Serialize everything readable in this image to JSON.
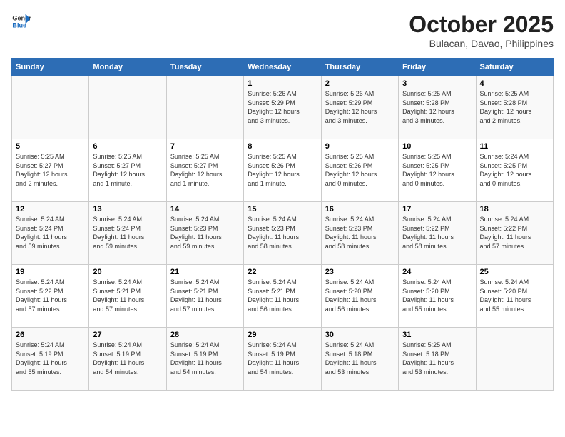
{
  "header": {
    "logo_line1": "General",
    "logo_line2": "Blue",
    "month": "October 2025",
    "location": "Bulacan, Davao, Philippines"
  },
  "weekdays": [
    "Sunday",
    "Monday",
    "Tuesday",
    "Wednesday",
    "Thursday",
    "Friday",
    "Saturday"
  ],
  "weeks": [
    [
      {
        "day": "",
        "info": ""
      },
      {
        "day": "",
        "info": ""
      },
      {
        "day": "",
        "info": ""
      },
      {
        "day": "1",
        "info": "Sunrise: 5:26 AM\nSunset: 5:29 PM\nDaylight: 12 hours\nand 3 minutes."
      },
      {
        "day": "2",
        "info": "Sunrise: 5:26 AM\nSunset: 5:29 PM\nDaylight: 12 hours\nand 3 minutes."
      },
      {
        "day": "3",
        "info": "Sunrise: 5:25 AM\nSunset: 5:28 PM\nDaylight: 12 hours\nand 3 minutes."
      },
      {
        "day": "4",
        "info": "Sunrise: 5:25 AM\nSunset: 5:28 PM\nDaylight: 12 hours\nand 2 minutes."
      }
    ],
    [
      {
        "day": "5",
        "info": "Sunrise: 5:25 AM\nSunset: 5:27 PM\nDaylight: 12 hours\nand 2 minutes."
      },
      {
        "day": "6",
        "info": "Sunrise: 5:25 AM\nSunset: 5:27 PM\nDaylight: 12 hours\nand 1 minute."
      },
      {
        "day": "7",
        "info": "Sunrise: 5:25 AM\nSunset: 5:27 PM\nDaylight: 12 hours\nand 1 minute."
      },
      {
        "day": "8",
        "info": "Sunrise: 5:25 AM\nSunset: 5:26 PM\nDaylight: 12 hours\nand 1 minute."
      },
      {
        "day": "9",
        "info": "Sunrise: 5:25 AM\nSunset: 5:26 PM\nDaylight: 12 hours\nand 0 minutes."
      },
      {
        "day": "10",
        "info": "Sunrise: 5:25 AM\nSunset: 5:25 PM\nDaylight: 12 hours\nand 0 minutes."
      },
      {
        "day": "11",
        "info": "Sunrise: 5:24 AM\nSunset: 5:25 PM\nDaylight: 12 hours\nand 0 minutes."
      }
    ],
    [
      {
        "day": "12",
        "info": "Sunrise: 5:24 AM\nSunset: 5:24 PM\nDaylight: 11 hours\nand 59 minutes."
      },
      {
        "day": "13",
        "info": "Sunrise: 5:24 AM\nSunset: 5:24 PM\nDaylight: 11 hours\nand 59 minutes."
      },
      {
        "day": "14",
        "info": "Sunrise: 5:24 AM\nSunset: 5:23 PM\nDaylight: 11 hours\nand 59 minutes."
      },
      {
        "day": "15",
        "info": "Sunrise: 5:24 AM\nSunset: 5:23 PM\nDaylight: 11 hours\nand 58 minutes."
      },
      {
        "day": "16",
        "info": "Sunrise: 5:24 AM\nSunset: 5:23 PM\nDaylight: 11 hours\nand 58 minutes."
      },
      {
        "day": "17",
        "info": "Sunrise: 5:24 AM\nSunset: 5:22 PM\nDaylight: 11 hours\nand 58 minutes."
      },
      {
        "day": "18",
        "info": "Sunrise: 5:24 AM\nSunset: 5:22 PM\nDaylight: 11 hours\nand 57 minutes."
      }
    ],
    [
      {
        "day": "19",
        "info": "Sunrise: 5:24 AM\nSunset: 5:22 PM\nDaylight: 11 hours\nand 57 minutes."
      },
      {
        "day": "20",
        "info": "Sunrise: 5:24 AM\nSunset: 5:21 PM\nDaylight: 11 hours\nand 57 minutes."
      },
      {
        "day": "21",
        "info": "Sunrise: 5:24 AM\nSunset: 5:21 PM\nDaylight: 11 hours\nand 57 minutes."
      },
      {
        "day": "22",
        "info": "Sunrise: 5:24 AM\nSunset: 5:21 PM\nDaylight: 11 hours\nand 56 minutes."
      },
      {
        "day": "23",
        "info": "Sunrise: 5:24 AM\nSunset: 5:20 PM\nDaylight: 11 hours\nand 56 minutes."
      },
      {
        "day": "24",
        "info": "Sunrise: 5:24 AM\nSunset: 5:20 PM\nDaylight: 11 hours\nand 55 minutes."
      },
      {
        "day": "25",
        "info": "Sunrise: 5:24 AM\nSunset: 5:20 PM\nDaylight: 11 hours\nand 55 minutes."
      }
    ],
    [
      {
        "day": "26",
        "info": "Sunrise: 5:24 AM\nSunset: 5:19 PM\nDaylight: 11 hours\nand 55 minutes."
      },
      {
        "day": "27",
        "info": "Sunrise: 5:24 AM\nSunset: 5:19 PM\nDaylight: 11 hours\nand 54 minutes."
      },
      {
        "day": "28",
        "info": "Sunrise: 5:24 AM\nSunset: 5:19 PM\nDaylight: 11 hours\nand 54 minutes."
      },
      {
        "day": "29",
        "info": "Sunrise: 5:24 AM\nSunset: 5:19 PM\nDaylight: 11 hours\nand 54 minutes."
      },
      {
        "day": "30",
        "info": "Sunrise: 5:24 AM\nSunset: 5:18 PM\nDaylight: 11 hours\nand 53 minutes."
      },
      {
        "day": "31",
        "info": "Sunrise: 5:25 AM\nSunset: 5:18 PM\nDaylight: 11 hours\nand 53 minutes."
      },
      {
        "day": "",
        "info": ""
      }
    ]
  ]
}
